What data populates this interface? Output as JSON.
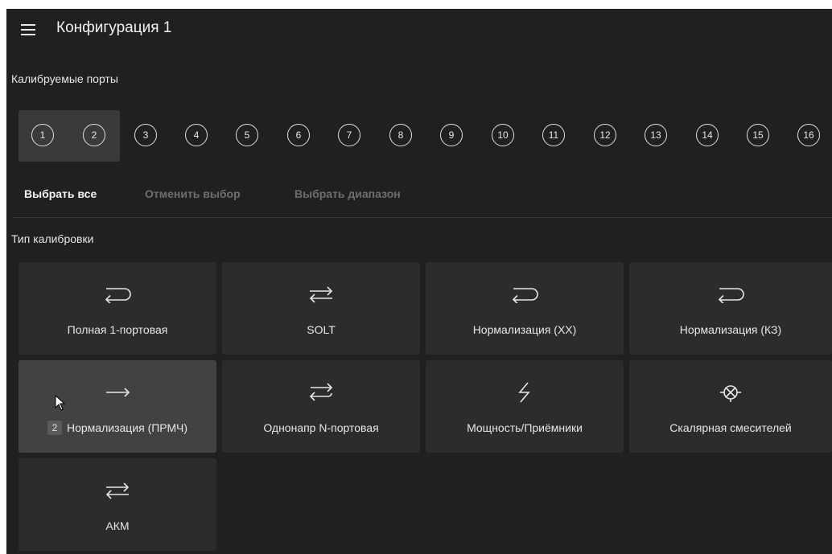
{
  "header": {
    "title": "Конфигурация 1"
  },
  "ports_section": {
    "label": "Калибруемые порты"
  },
  "ports": [
    {
      "label": "1",
      "selected": true
    },
    {
      "label": "2",
      "selected": true
    },
    {
      "label": "3",
      "selected": false
    },
    {
      "label": "4",
      "selected": false
    },
    {
      "label": "5",
      "selected": false
    },
    {
      "label": "6",
      "selected": false
    },
    {
      "label": "7",
      "selected": false
    },
    {
      "label": "8",
      "selected": false
    },
    {
      "label": "9",
      "selected": false
    },
    {
      "label": "10",
      "selected": false
    },
    {
      "label": "11",
      "selected": false
    },
    {
      "label": "12",
      "selected": false
    },
    {
      "label": "13",
      "selected": false
    },
    {
      "label": "14",
      "selected": false
    },
    {
      "label": "15",
      "selected": false
    },
    {
      "label": "16",
      "selected": false
    }
  ],
  "actions": {
    "select_all": "Выбрать все",
    "deselect": "Отменить выбор",
    "select_range": "Выбрать диапазон"
  },
  "cal_type_section": {
    "label": "Тип калибровки"
  },
  "cal_types": [
    {
      "label": "Полная 1-портовая",
      "icon": "reflect-arrow-icon"
    },
    {
      "label": "SOLT",
      "icon": "bidirectional-arrows-icon"
    },
    {
      "label": "Нормализация (ХХ)",
      "icon": "reflect-arrow-icon"
    },
    {
      "label": "Нормализация (КЗ)",
      "icon": "reflect-arrow-icon"
    },
    {
      "label": "Нормализация (ПРМЧ)",
      "icon": "right-arrow-icon",
      "badge": "2",
      "selected": true
    },
    {
      "label": "Однонапр N-портовая",
      "icon": "oneway-nport-icon"
    },
    {
      "label": "Мощность/Приёмники",
      "icon": "lightning-icon"
    },
    {
      "label": "Скалярная смесителей",
      "icon": "mixer-icon"
    },
    {
      "label": "АКМ",
      "icon": "bidirectional-arrows-icon"
    }
  ]
}
